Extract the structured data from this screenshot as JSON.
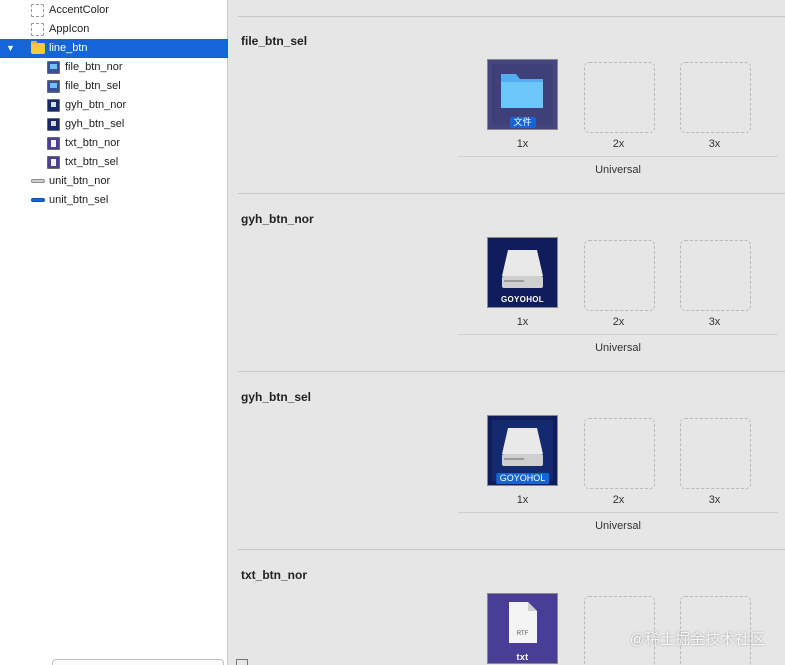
{
  "sidebar": {
    "items": [
      {
        "label": "AccentColor",
        "icon": "color-set-icon",
        "kind": "dashed",
        "level": 1
      },
      {
        "label": "AppIcon",
        "icon": "app-icon-set-icon",
        "kind": "dashed",
        "level": 1
      },
      {
        "label": "line_btn",
        "icon": "folder-icon",
        "kind": "folder",
        "level": 1,
        "selected": true,
        "expanded": true
      },
      {
        "label": "file_btn_nor",
        "icon": "image-set-icon",
        "kind": "file",
        "level": 2
      },
      {
        "label": "file_btn_sel",
        "icon": "image-set-icon",
        "kind": "file",
        "level": 2
      },
      {
        "label": "gyh_btn_nor",
        "icon": "image-set-icon",
        "kind": "gyh",
        "level": 2
      },
      {
        "label": "gyh_btn_sel",
        "icon": "image-set-icon",
        "kind": "gyh",
        "level": 2
      },
      {
        "label": "txt_btn_nor",
        "icon": "image-set-icon",
        "kind": "txt",
        "level": 2
      },
      {
        "label": "txt_btn_sel",
        "icon": "image-set-icon",
        "kind": "txt",
        "level": 2
      },
      {
        "label": "unit_btn_nor",
        "icon": "image-set-icon",
        "kind": "line",
        "level": 1
      },
      {
        "label": "unit_btn_sel",
        "icon": "image-set-icon",
        "kind": "line-blue",
        "level": 1
      }
    ]
  },
  "scales": {
    "s1": "1x",
    "s2": "2x",
    "s3": "3x"
  },
  "universal_label": "Universal",
  "sets": [
    {
      "name": "file_btn_sel",
      "image_caption": "文件"
    },
    {
      "name": "gyh_btn_nor",
      "image_caption": "GOYOHOL"
    },
    {
      "name": "gyh_btn_sel",
      "image_caption": "GOYOHOL"
    },
    {
      "name": "txt_btn_nor",
      "image_caption": "txt",
      "doc_label": "RTF"
    }
  ],
  "watermark": "@稀土掘金技术社区",
  "colors": {
    "selection": "#1565d8",
    "folder": "#f5c842"
  }
}
